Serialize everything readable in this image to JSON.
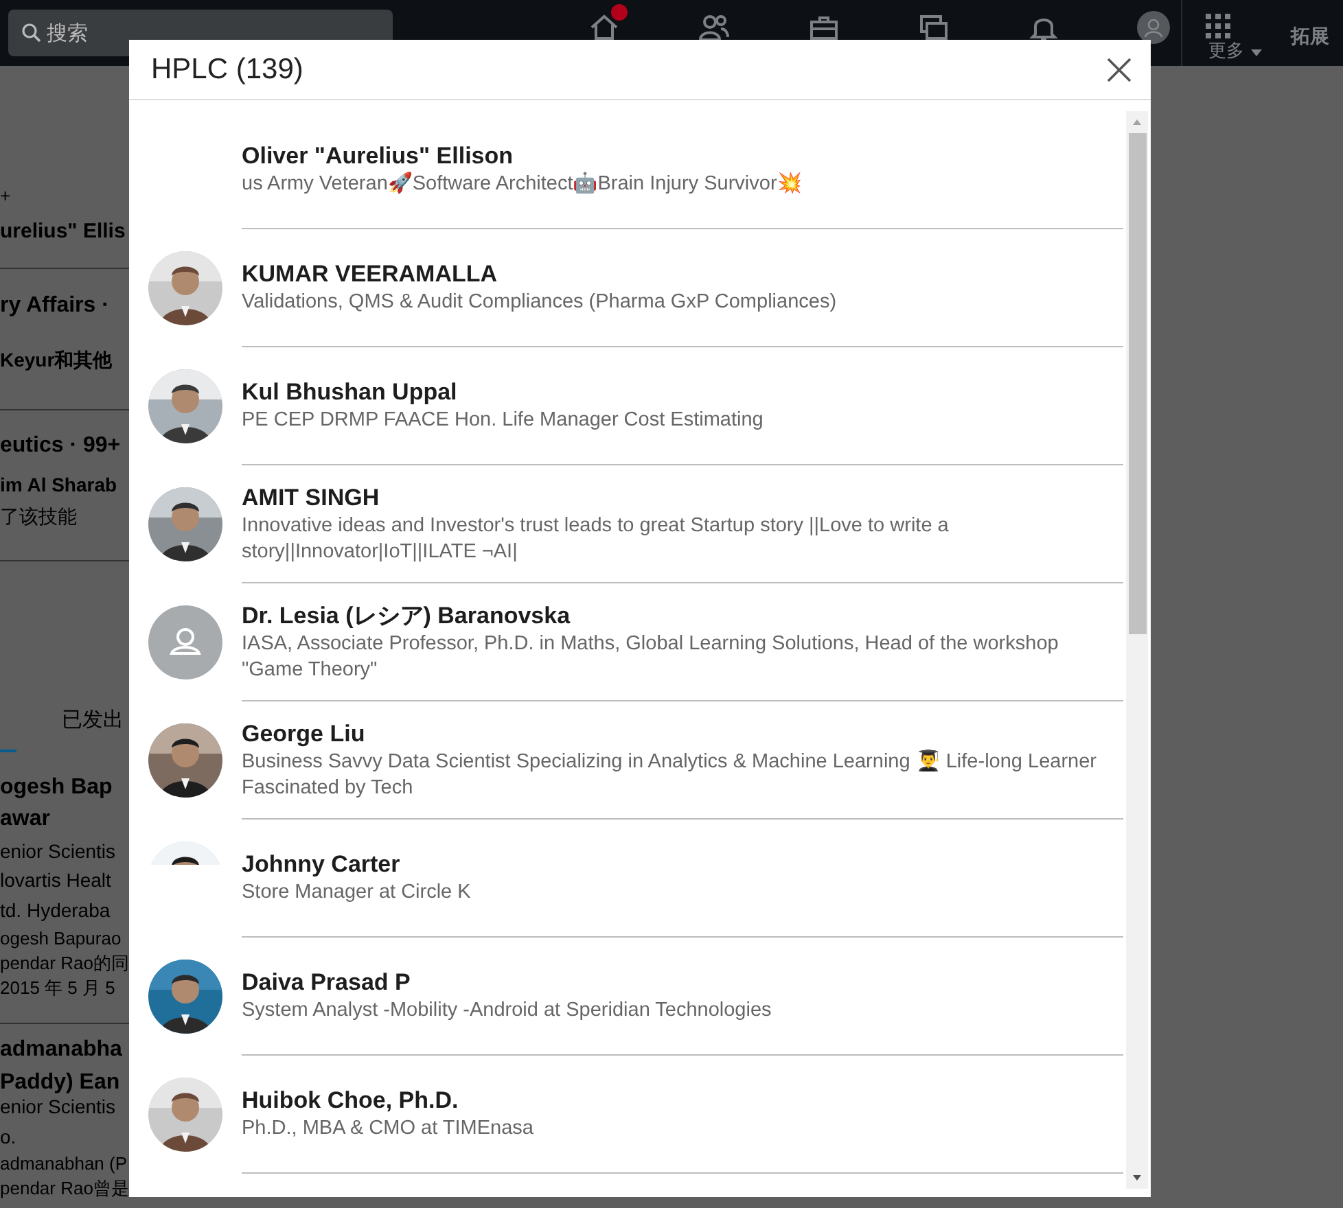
{
  "nav": {
    "search": {
      "placeholder": "搜索"
    },
    "icons": [
      {
        "kind": "home",
        "badge": true
      },
      {
        "kind": "people",
        "badge": false
      },
      {
        "kind": "briefcase",
        "badge": false
      },
      {
        "kind": "chat",
        "badge": false
      },
      {
        "kind": "bell",
        "badge": false
      },
      {
        "kind": "avatar",
        "badge": false
      }
    ],
    "more": "更多",
    "extra": "拓展"
  },
  "background_page": {
    "lines": [
      {
        "kind": "muted",
        "text": "+"
      },
      {
        "kind": "bold",
        "text": "urelius\" Ellis"
      },
      {
        "kind": "rule"
      },
      {
        "kind": "bold-large",
        "text": "ry Affairs ·"
      },
      {
        "kind": "text-bold",
        "text": "Keyur和其他"
      },
      {
        "kind": "rule"
      },
      {
        "kind": "bold-large",
        "text": "eutics · 99+"
      },
      {
        "kind": "text-bold",
        "text": "im Al Sharab"
      },
      {
        "kind": "text",
        "text": "了该技能"
      },
      {
        "kind": "rule"
      },
      {
        "kind": "tab",
        "text": "已发出"
      },
      {
        "kind": "bold-large",
        "text": "ogesh Bap"
      },
      {
        "kind": "bold-large",
        "text": "awar"
      },
      {
        "kind": "text-large",
        "text": "enior Scientis"
      },
      {
        "kind": "text-large",
        "text": "lovartis Healt"
      },
      {
        "kind": "text-large",
        "text": "td. Hyderaba"
      },
      {
        "kind": "small",
        "text": "ogesh Bapurao"
      },
      {
        "kind": "small",
        "text": "pendar Rao的同"
      },
      {
        "kind": "small",
        "text": "2015 年 5 月 5"
      },
      {
        "kind": "rule"
      },
      {
        "kind": "bold-large",
        "text": "admanabha"
      },
      {
        "kind": "bold-large",
        "text": "Paddy) Ean"
      },
      {
        "kind": "text-large",
        "text": "enior Scientis"
      },
      {
        "kind": "text-large",
        "text": "o."
      },
      {
        "kind": "small",
        "text": "admanabhan (P"
      },
      {
        "kind": "small",
        "text": "pendar Rao曾是"
      }
    ]
  },
  "dialog": {
    "title": "HPLC (139)",
    "people": [
      {
        "name": "Oliver \"Aurelius\" Ellison",
        "headline": "us Army Veteran🚀Software Architect🤖Brain Injury Survivor💥",
        "kind": "none"
      },
      {
        "name": "KUMAR VEERAMALLA",
        "headline": "Validations, QMS & Audit Compliances (Pharma GxP Compliances)"
      },
      {
        "name": "Kul Bhushan Uppal",
        "headline": "PE CEP DRMP FAACE Hon. Life Manager Cost Estimating"
      },
      {
        "name": "AMIT SINGH",
        "headline": "Innovative ideas and Investor's trust leads to great Startup story ||Love to write a story||Innovator|IoT||ILATE ¬AI|"
      },
      {
        "name": "Dr. Lesia (レシア) Baranovska",
        "headline": "IASA, Associate Professor, Ph.D. in Maths, Global Learning Solutions, Head of the workshop \"Game Theory\"",
        "kind": "placeholder"
      },
      {
        "name": "George Liu",
        "headline": "Business Savvy Data Scientist Specializing in Analytics & Machine Learning 👨‍🎓 Life-long Learner Fascinated by Tech"
      },
      {
        "name": "Johnny Carter",
        "headline": "Store Manager at Circle K",
        "kind": "photo_partial"
      },
      {
        "name": "Daiva Prasad P",
        "headline": "System Analyst -Mobility -Android at Speridian Technologies"
      },
      {
        "name": "Huibok Choe, Ph.D.",
        "headline": "Ph.D., MBA & CMO at TIMEnasa"
      }
    ]
  }
}
